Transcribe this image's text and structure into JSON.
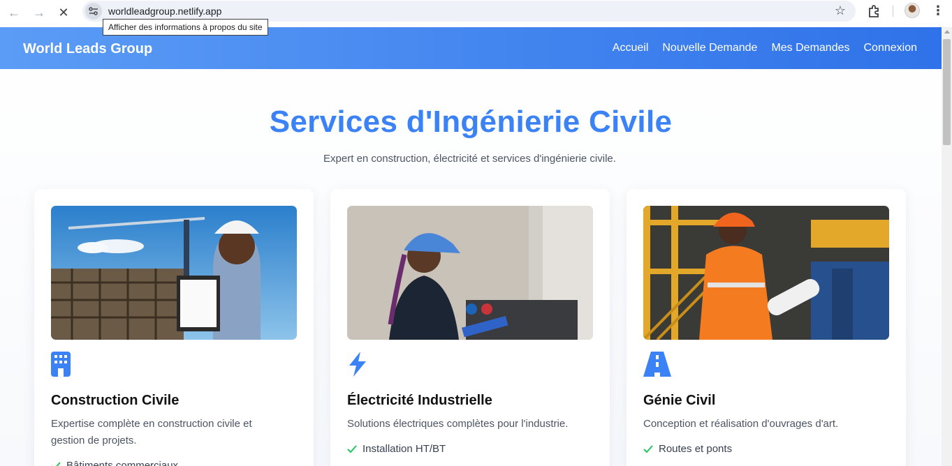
{
  "browser": {
    "url": "worldleadgroup.netlify.app",
    "site_info_tooltip": "Afficher des informations à propos du site"
  },
  "header": {
    "brand": "World Leads Group",
    "nav": [
      "Accueil",
      "Nouvelle Demande",
      "Mes Demandes",
      "Connexion"
    ]
  },
  "hero": {
    "title": "Services d'Ingénierie Civile",
    "subtitle": "Expert en construction, électricité et services d'ingénierie civile."
  },
  "cards": [
    {
      "icon": "building-icon",
      "title": "Construction Civile",
      "description": "Expertise complète en construction civile et gestion de projets.",
      "features": [
        "Bâtiments commerciaux"
      ]
    },
    {
      "icon": "bolt-icon",
      "title": "Électricité Industrielle",
      "description": "Solutions électriques complètes pour l'industrie.",
      "features": [
        "Installation HT/BT"
      ]
    },
    {
      "icon": "road-icon",
      "title": "Génie Civil",
      "description": "Conception et réalisation d'ouvrages d'art.",
      "features": [
        "Routes et ponts"
      ]
    }
  ],
  "colors": {
    "accent": "#3b82f6",
    "header_start": "#5b9cf6",
    "header_end": "#2f72e9",
    "check": "#22c55e"
  }
}
